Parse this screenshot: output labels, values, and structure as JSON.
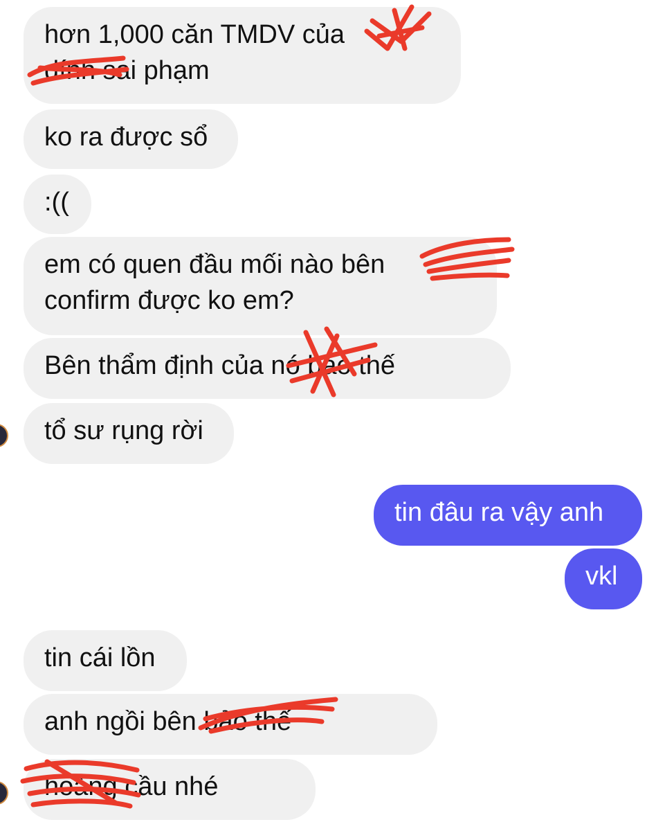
{
  "conversation": {
    "messages": [
      {
        "side": "incoming",
        "lines": [
          "hơn 1,000 căn TMDV của ",
          "          dính sai phạm"
        ]
      },
      {
        "side": "incoming",
        "lines": [
          "ko ra được sổ"
        ]
      },
      {
        "side": "incoming",
        "lines": [
          ":(("
        ]
      },
      {
        "side": "incoming",
        "lines": [
          "em có quen đầu mối nào bên",
          "confirm được ko em?"
        ]
      },
      {
        "side": "incoming",
        "lines": [
          "Bên thẩm định của      nó báo thế"
        ]
      },
      {
        "side": "incoming",
        "lines": [
          "tổ sư rụng rời"
        ]
      },
      {
        "side": "outgoing",
        "lines": [
          "tin đâu ra vậy anh"
        ]
      },
      {
        "side": "outgoing",
        "lines": [
          "vkl"
        ]
      },
      {
        "side": "incoming",
        "lines": [
          "tin cái lồn"
        ]
      },
      {
        "side": "incoming",
        "lines": [
          "anh ngồi bên            bảo thế"
        ]
      },
      {
        "side": "incoming",
        "lines": [
          "           hoàng cầu nhé"
        ]
      }
    ]
  },
  "colors": {
    "incoming_bubble": "#f0f0f0",
    "outgoing_bubble": "#5858f0",
    "redaction": "#ea3a2a"
  },
  "icons": {
    "avatar": "avatar-icon",
    "redaction": "red-scribble-redaction"
  }
}
